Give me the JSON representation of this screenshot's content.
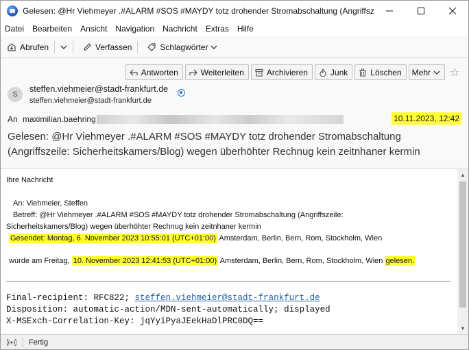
{
  "window": {
    "title": "Gelesen: @Hr Viehmeyer .#ALARM #SOS #MAYDY totz drohender Stromabschaltung (Angriffsze..."
  },
  "menubar": {
    "items": [
      "Datei",
      "Bearbeiten",
      "Ansicht",
      "Navigation",
      "Nachricht",
      "Extras",
      "Hilfe"
    ]
  },
  "toolbar": {
    "get_mail": "Abrufen",
    "compose": "Verfassen",
    "tags": "Schlagwörter"
  },
  "header_buttons": {
    "reply": "Antworten",
    "forward": "Weiterleiten",
    "archive": "Archivieren",
    "junk": "Junk",
    "delete": "Löschen",
    "more": "Mehr"
  },
  "message": {
    "avatar_initial": "S",
    "from_name": "steffen.viehmeier@stadt-frankfurt.de",
    "from_address": "steffen.viehmeier@stadt-frankfurt.de",
    "to_label": "An",
    "to_value": "maximilian.baehring",
    "date": "10.11.2023, 12:42",
    "subject": "Gelesen: @Hr Viehmeyer .#ALARM #SOS #MAYDY totz drohender Stromabschaltung (Angriffszeile: Sicherheitskamers/Blog) wegen überhöhter Rechnug kein zeitnhaner kermin"
  },
  "body": {
    "intro": "Ihre Nachricht",
    "to_line": "An: Viehmeier, Steffen",
    "subject_line_1": "Betreff: @Hr Viehmeyer .#ALARM #SOS #MAYDY totz drohender Stromabschaltung (Angriffszeile:",
    "subject_line_2": "Sicherheitskamers/Blog) wegen überhöhter Rechnug kein zeitnhaner kermin",
    "sent_highlight": "Gesendet: Montag, 6. November 2023 10:55:01 (UTC+01:00)",
    "sent_tz": " Amsterdam, Berlin, Bern, Rom, Stockholm, Wien",
    "read_prefix": "wurde am Freitag, ",
    "read_highlight": "10. November 2023 12:41:53 (UTC+01:00)",
    "read_tz": " Amsterdam, Berlin, Bern, Rom, Stockholm, Wien ",
    "read_word": "gelesen.",
    "mdn_recipient_label": "Final-recipient: RFC822; ",
    "mdn_recipient_link": "steffen.viehmeier@stadt-frankfurt.de",
    "mdn_disposition": "Disposition: automatic-action/MDN-sent-automatically; displayed",
    "mdn_correlation": "X-MSExch-Correlation-Key: jqYyiPyaJEekHaDlPRC0DQ=="
  },
  "status": {
    "text": "Fertig"
  },
  "colors": {
    "highlight": "#ffff33",
    "link": "#1f5fa8"
  }
}
